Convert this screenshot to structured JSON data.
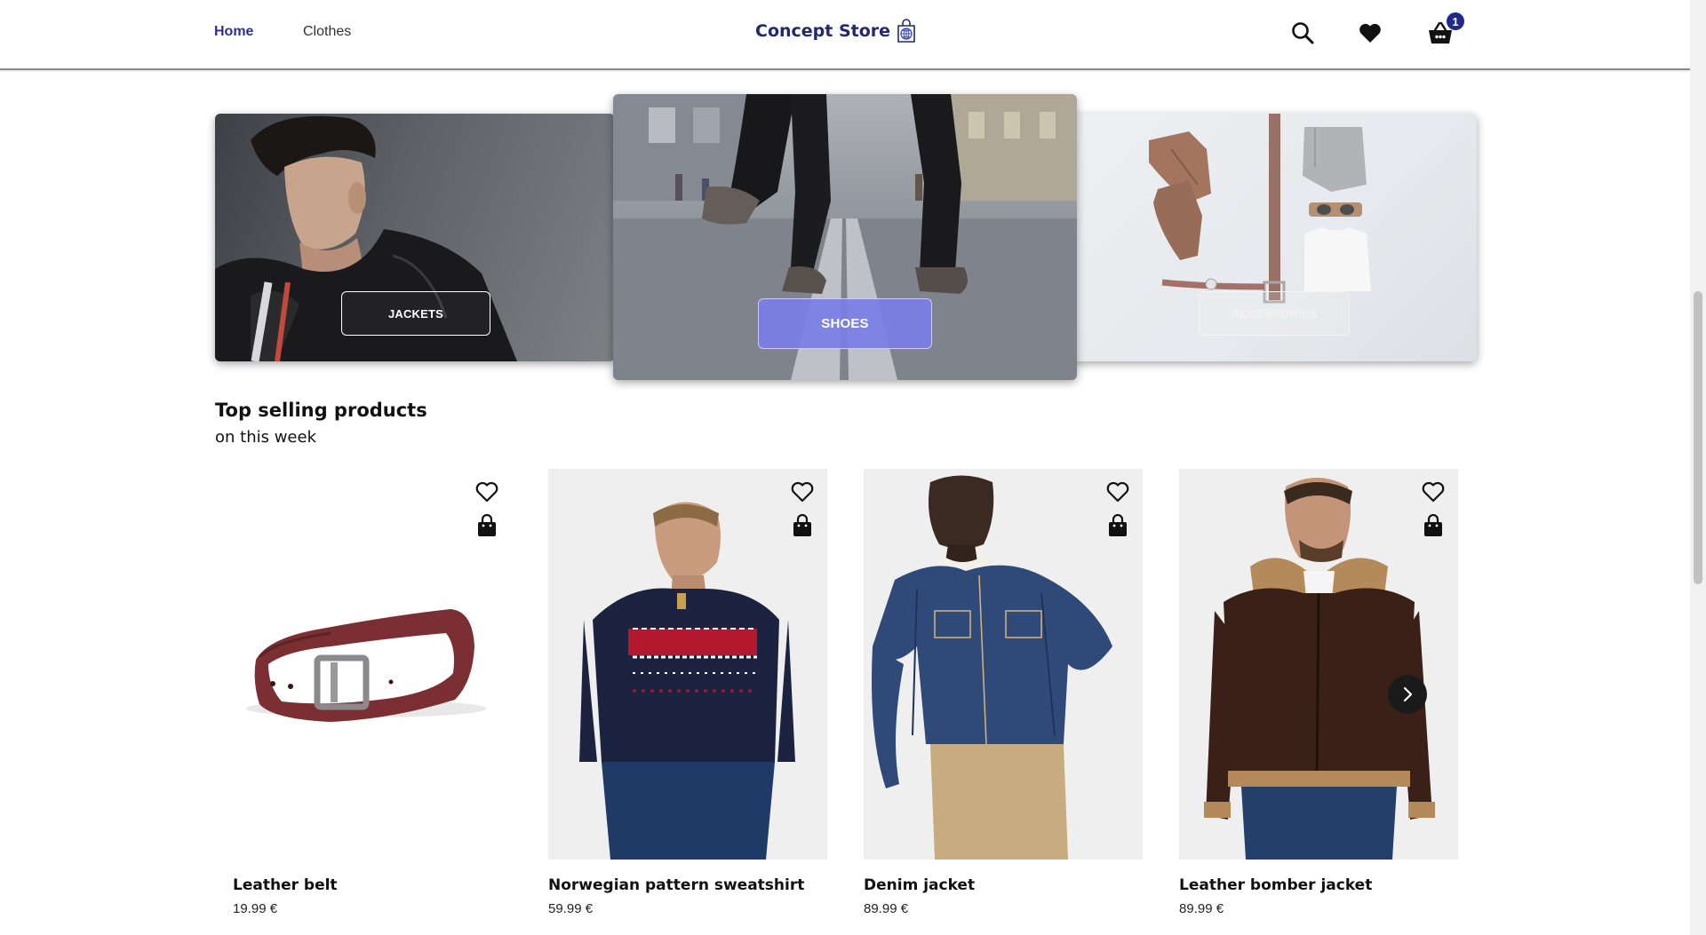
{
  "header": {
    "nav": [
      {
        "label": "Home",
        "active": true
      },
      {
        "label": "Clothes",
        "active": false
      }
    ],
    "brand": "Concept Store",
    "icons": [
      "search-icon",
      "heart-icon",
      "basket-icon"
    ],
    "cart_count": "1"
  },
  "categories": [
    {
      "label": "JACKETS"
    },
    {
      "label": "SHOES"
    },
    {
      "label": "ACCESSORIES"
    }
  ],
  "section": {
    "title": "Top selling products",
    "subtitle": "on this week"
  },
  "products": [
    {
      "name": "Leather belt",
      "price": "19.99 €"
    },
    {
      "name": "Norwegian pattern sweatshirt",
      "price": "59.99 €"
    },
    {
      "name": "Denim jacket",
      "price": "89.99 €"
    },
    {
      "name": "Leather bomber jacket",
      "price": "89.99 €"
    }
  ],
  "colors": {
    "accent": "#2e3192",
    "brand": "#22296b",
    "badge": "#1f2a8a",
    "shoes_button": "#7a7ee6"
  }
}
